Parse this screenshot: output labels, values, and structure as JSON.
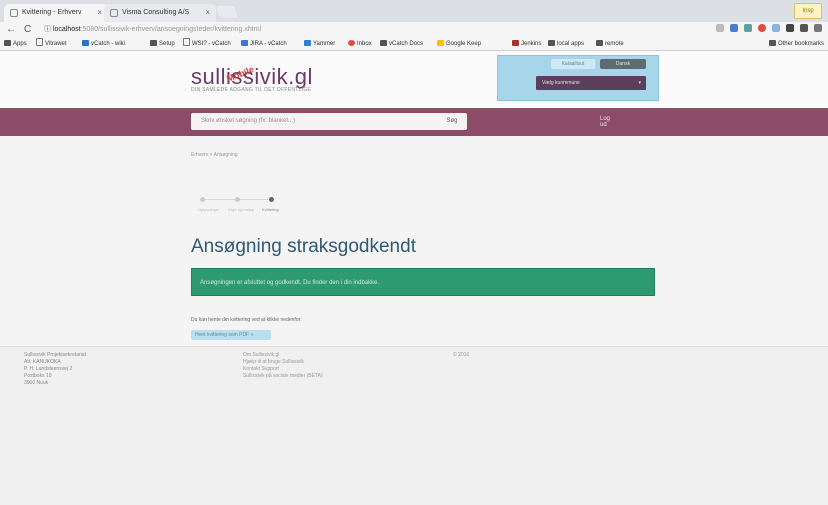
{
  "browser": {
    "tabs": [
      {
        "title": "Kvittering - Erhverv"
      },
      {
        "title": "Visma Consulting A/S"
      }
    ],
    "notice_badge": "Insp",
    "address": {
      "host": "localhost",
      "path": ":5080/sullissivik-erhverv/ansoegningsteder/kvittering.xhtml"
    },
    "bookmarks": [
      {
        "label": "Apps"
      },
      {
        "label": "Vitrawet"
      },
      {
        "label": "vCatch - wiki"
      },
      {
        "label": "Setup"
      },
      {
        "label": "WSI? - vCatch"
      },
      {
        "label": "JIRA - vCatch"
      },
      {
        "label": "Yammer"
      },
      {
        "label": "Inbox"
      },
      {
        "label": "vCatch Docs"
      },
      {
        "label": "Google Keep"
      },
      {
        "label": "Jenkins"
      },
      {
        "label": "local apps"
      },
      {
        "label": "remote"
      }
    ],
    "other_bookmarks": "Other bookmarks"
  },
  "site": {
    "logo": "sullissivik.gl",
    "logo_stamp": "Mobile",
    "tagline": "DIN SAMLEDE ADGANG TIL DET OFFENTLIGE",
    "lang_kal": "Kalaallisut",
    "lang_dan": "Dansk",
    "company_select": "Vælg kunmmune",
    "search_placeholder": "Skriv ønsket søgning (fx: blanket...)",
    "search_button": "Søg",
    "logout_line1": "Log",
    "logout_line2": "ud"
  },
  "page": {
    "breadcrumb": "Erhverv > Ansøgning",
    "steps": [
      "Oplysninger",
      "Afgiv hjemstop",
      "Kvittering"
    ],
    "title": "Ansøgning straksgodkendt",
    "alert": "Ansøgningen er afsluttet og godkendt. Du finder den i din indbakke.",
    "download_text": "Du kan hente din kvittering ved at klikke nedenfor:",
    "download_button": "Hent kvittering som PDF »"
  },
  "footer": {
    "col1": [
      "Sullissivik Projektsekretariat",
      "Att. KANUKOKA",
      "P. H. Lundsteensvej 2",
      "Postboks 10",
      "3900 Nuuk"
    ],
    "col2": [
      "Om Sullissivik.gl",
      "Hjælp til at bruge Sullissivik",
      "Kontakt Support",
      "Sullissivik på sociale medier (BETA)"
    ],
    "col3": [
      "© 2016"
    ]
  },
  "colors": {
    "brand_purple": "#8c4c68",
    "success_green": "#2e9a72",
    "title_blue": "#2e5a74",
    "lang_box": "#a7d6ea"
  }
}
